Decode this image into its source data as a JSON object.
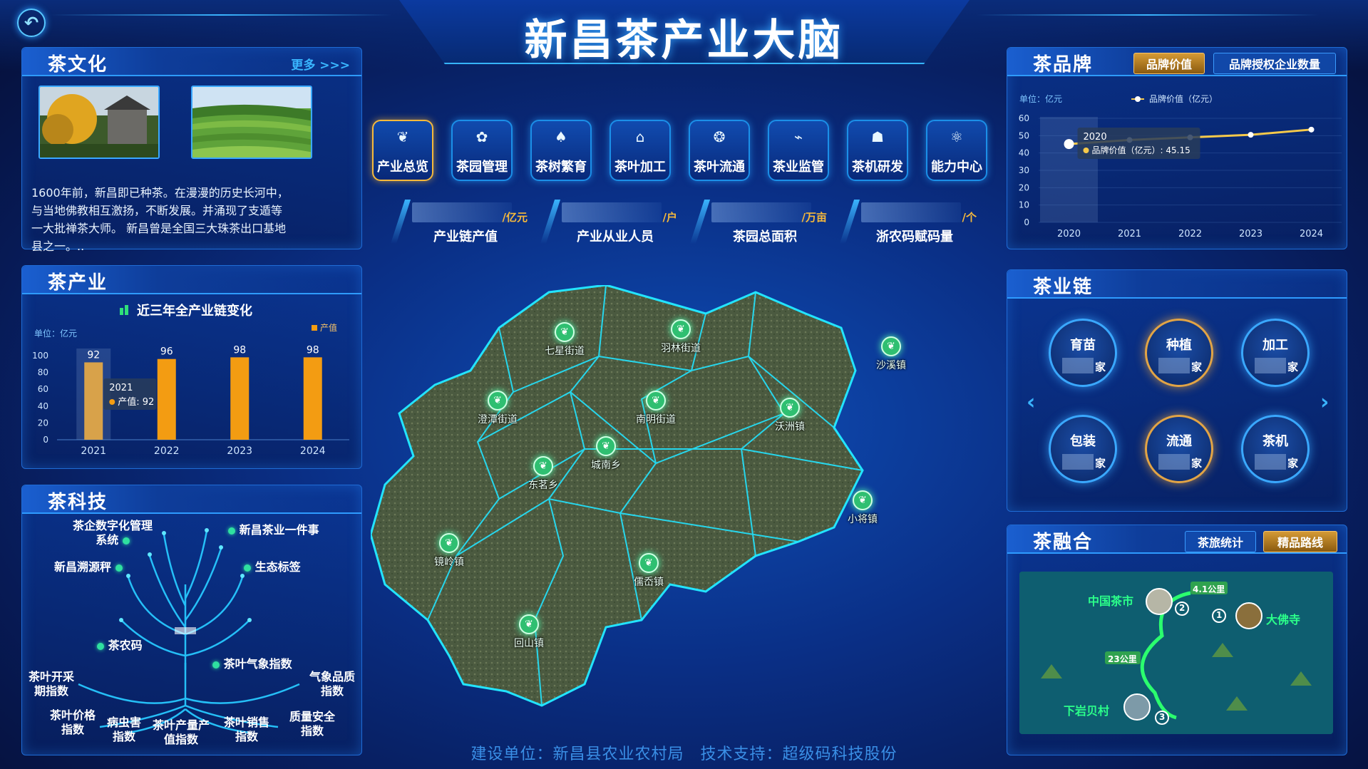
{
  "header": {
    "title": "新昌茶产业大脑",
    "back_icon": "back-arrow-icon"
  },
  "culture": {
    "title": "茶文化",
    "more": "更多 >>>",
    "photos": [
      "tea-temple-photo",
      "tea-garden-photo"
    ],
    "text": "1600年前，新昌即已种茶。在漫漫的历史长河中，与当地佛教相互激扬，不断发展。并涌现了支遁等一大批禅茶大师。 新昌曾是全国三大珠茶出口基地县之一。.."
  },
  "industry": {
    "title": "茶产业",
    "chart_data": {
      "type": "bar",
      "title": "近三年全产业链变化",
      "unit_label": "单位：亿元",
      "legend": "产值",
      "categories": [
        "2021",
        "2022",
        "2023",
        "2024"
      ],
      "values": [
        92,
        96,
        98,
        98
      ],
      "ylim": [
        0,
        100
      ],
      "yticks": [
        "0",
        "20",
        "40",
        "60",
        "80",
        "100"
      ],
      "tooltip": {
        "year": "2021",
        "text": "产值: 92"
      },
      "color": "#f39c12"
    }
  },
  "tech": {
    "title": "茶科技",
    "labels": {
      "digital": "茶企数字化管理系统",
      "one_thing": "新昌茶业一件事",
      "trace": "新昌溯源秤",
      "eco": "生态标签",
      "code": "茶农码",
      "weather": "茶叶气象指数",
      "pick": "茶叶开采期指数",
      "quality_w": "气象品质指数",
      "price": "茶叶价格指数",
      "pest": "病虫害指数",
      "output": "茶叶产量产值指数",
      "sales": "茶叶销售指数",
      "safety": "质量安全指数"
    }
  },
  "nav": {
    "items": [
      {
        "label": "产业总览",
        "icon": "sprout-icon"
      },
      {
        "label": "茶园管理",
        "icon": "garden-icon"
      },
      {
        "label": "茶树繁育",
        "icon": "breeding-icon"
      },
      {
        "label": "茶叶加工",
        "icon": "factory-icon"
      },
      {
        "label": "茶叶流通",
        "icon": "circulation-icon"
      },
      {
        "label": "茶业监管",
        "icon": "monitor-icon"
      },
      {
        "label": "茶机研发",
        "icon": "machine-icon"
      },
      {
        "label": "能力中心",
        "icon": "atom-icon"
      }
    ]
  },
  "stats": [
    {
      "unit": "/亿元",
      "label": "产业链产值"
    },
    {
      "unit": "/户",
      "label": "产业从业人员"
    },
    {
      "unit": "/万亩",
      "label": "茶园总面积"
    },
    {
      "unit": "/个",
      "label": "浙农码赋码量"
    }
  ],
  "map": {
    "towns": [
      {
        "name": "七星街道"
      },
      {
        "name": "羽林街道"
      },
      {
        "name": "沙溪镇"
      },
      {
        "name": "澄潭街道"
      },
      {
        "name": "南明街道"
      },
      {
        "name": "沃洲镇"
      },
      {
        "name": "东茗乡"
      },
      {
        "name": "城南乡"
      },
      {
        "name": "小将镇"
      },
      {
        "name": "镜岭镇"
      },
      {
        "name": "儒岙镇"
      },
      {
        "name": "回山镇"
      }
    ]
  },
  "brand": {
    "title": "茶品牌",
    "tabs": [
      "品牌价值",
      "品牌授权企业数量"
    ],
    "chart_data": {
      "type": "line",
      "unit_label": "单位：亿元",
      "legend": "品牌价值（亿元）",
      "categories": [
        "2020",
        "2021",
        "2022",
        "2023",
        "2024"
      ],
      "values": [
        45.15,
        47.5,
        49.0,
        50.5,
        53.5
      ],
      "ylim": [
        0,
        60
      ],
      "yticks": [
        "0",
        "10",
        "20",
        "30",
        "40",
        "50",
        "60"
      ],
      "tooltip": {
        "year": "2020",
        "text": "品牌价值（亿元）: 45.15"
      },
      "color": "#f6c94a"
    }
  },
  "chain": {
    "title": "茶业链",
    "items": [
      {
        "label": "育苗",
        "unit": "家"
      },
      {
        "label": "种植",
        "unit": "家"
      },
      {
        "label": "加工",
        "unit": "家"
      },
      {
        "label": "包装",
        "unit": "家"
      },
      {
        "label": "流通",
        "unit": "家"
      },
      {
        "label": "茶机",
        "unit": "家"
      }
    ]
  },
  "fusion": {
    "title": "茶融合",
    "tabs": [
      "茶旅统计",
      "精品路线"
    ],
    "places": {
      "p1": "中国茶市",
      "p2": "大佛寺",
      "p3": "下岩贝村"
    },
    "distances": {
      "d1": "4.1公里",
      "d2": "23公里"
    },
    "nums": {
      "n1": "1",
      "n2": "2",
      "n3": "3"
    }
  },
  "footer": {
    "text": "建设单位：新昌县农业农村局　技术支持：超级码科技股份"
  }
}
